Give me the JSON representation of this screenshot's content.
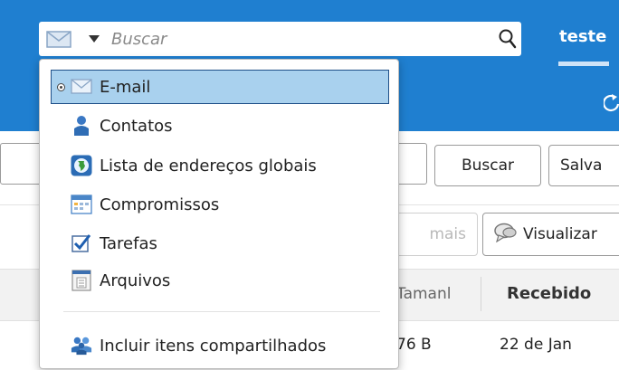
{
  "header": {
    "search": {
      "placeholder": "Buscar",
      "value": ""
    },
    "user_name": "teste"
  },
  "toolbar": {
    "buscar_label": "Buscar",
    "salvar_label": "Salva",
    "mais_label": "mais",
    "visualizar_label": "Visualizar"
  },
  "list": {
    "columns": {
      "tamanho": "Tamanl",
      "recebido": "Recebido"
    },
    "rows": [
      {
        "size": "76 B",
        "date": "22 de Jan"
      }
    ]
  },
  "dropdown": {
    "items": [
      {
        "label": "E-mail",
        "icon": "envelope-icon",
        "selected": true
      },
      {
        "label": "Contatos",
        "icon": "contact-person-icon",
        "selected": false
      },
      {
        "label": "Lista de endereços globais",
        "icon": "globe-icon",
        "selected": false
      },
      {
        "label": "Compromissos",
        "icon": "calendar-icon",
        "selected": false
      },
      {
        "label": "Tarefas",
        "icon": "checkbox-icon",
        "selected": false
      },
      {
        "label": "Arquivos",
        "icon": "document-icon",
        "selected": false
      }
    ],
    "shared_label": "Incluir itens compartilhados",
    "shared_icon": "shared-people-icon"
  },
  "colors": {
    "topbar": "#1f7fd0",
    "selection": "#a9d1ee",
    "selection_border": "#1f4f88"
  }
}
